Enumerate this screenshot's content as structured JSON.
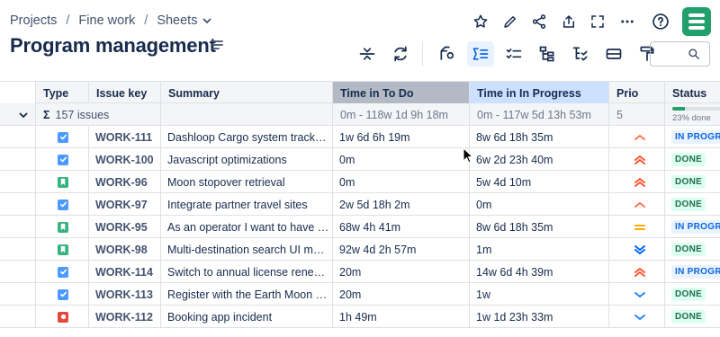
{
  "breadcrumb": [
    "Projects",
    "Fine work",
    "Sheets"
  ],
  "page_title": "Program management",
  "colors": {
    "brand": "#22a06b",
    "todo_header": "#b3bac5",
    "progress_header": "#cce0ff",
    "active_tool": "#e9f2ff"
  },
  "columns": {
    "type": "Type",
    "key": "Issue key",
    "summary": "Summary",
    "todo": "Time in To Do",
    "progress": "Time in In Progress",
    "prio": "Prio",
    "status": "Status"
  },
  "summary_row": {
    "sigma": "Σ",
    "count_label": "157 issues",
    "todo": "0m - 118w 1d 9h 18m",
    "progress": "0m - 117w 5d 13h 53m",
    "prio": "5",
    "status_progress": "23% done",
    "status_progress_value": 0.23
  },
  "rows": [
    {
      "type": "task",
      "key": "WORK-111",
      "summary": "Dashloop Cargo system track…",
      "todo": "1w 6d 6h 19m",
      "progress": "8w 6d 18h 35m",
      "prio": "medium",
      "status": "IN PROGRESS",
      "status_kind": "inprog"
    },
    {
      "type": "task",
      "key": "WORK-100",
      "summary": "Javascript optimizations",
      "todo": "0m",
      "progress": "6w 2d 23h 40m",
      "prio": "high",
      "status": "DONE",
      "status_kind": "done"
    },
    {
      "type": "story",
      "key": "WORK-96",
      "summary": "Moon stopover retrieval",
      "todo": "0m",
      "progress": "5w 4d 10m",
      "prio": "high",
      "status": "DONE",
      "status_kind": "done"
    },
    {
      "type": "task",
      "key": "WORK-97",
      "summary": "Integrate partner travel sites",
      "todo": "2w 5d 18h 2m",
      "progress": "0m",
      "prio": "medium",
      "status": "DONE",
      "status_kind": "done"
    },
    {
      "type": "story",
      "key": "WORK-95",
      "summary": "As an operator I want to have …",
      "todo": "68w 4h 41m",
      "progress": "8w 6d 18h 35m",
      "prio": "normal",
      "status": "IN PROGRESS",
      "status_kind": "inprog"
    },
    {
      "type": "story",
      "key": "WORK-98",
      "summary": "Multi-destination search UI m…",
      "todo": "92w 4d 2h 57m",
      "progress": "1m",
      "prio": "lowest",
      "status": "DONE",
      "status_kind": "done"
    },
    {
      "type": "task",
      "key": "WORK-114",
      "summary": "Switch to annual license rene…",
      "todo": "20m",
      "progress": "14w 6d 4h 39m",
      "prio": "high",
      "status": "IN PROGRESS",
      "status_kind": "inprog"
    },
    {
      "type": "task",
      "key": "WORK-113",
      "summary": "Register with the Earth Moon …",
      "todo": "20m",
      "progress": "1w",
      "prio": "low",
      "status": "DONE",
      "status_kind": "done"
    },
    {
      "type": "bug",
      "key": "WORK-112",
      "summary": "Booking app incident",
      "todo": "1h 49m",
      "progress": "1w 1d 23h 33m",
      "prio": "low",
      "status": "DONE",
      "status_kind": "done"
    }
  ]
}
